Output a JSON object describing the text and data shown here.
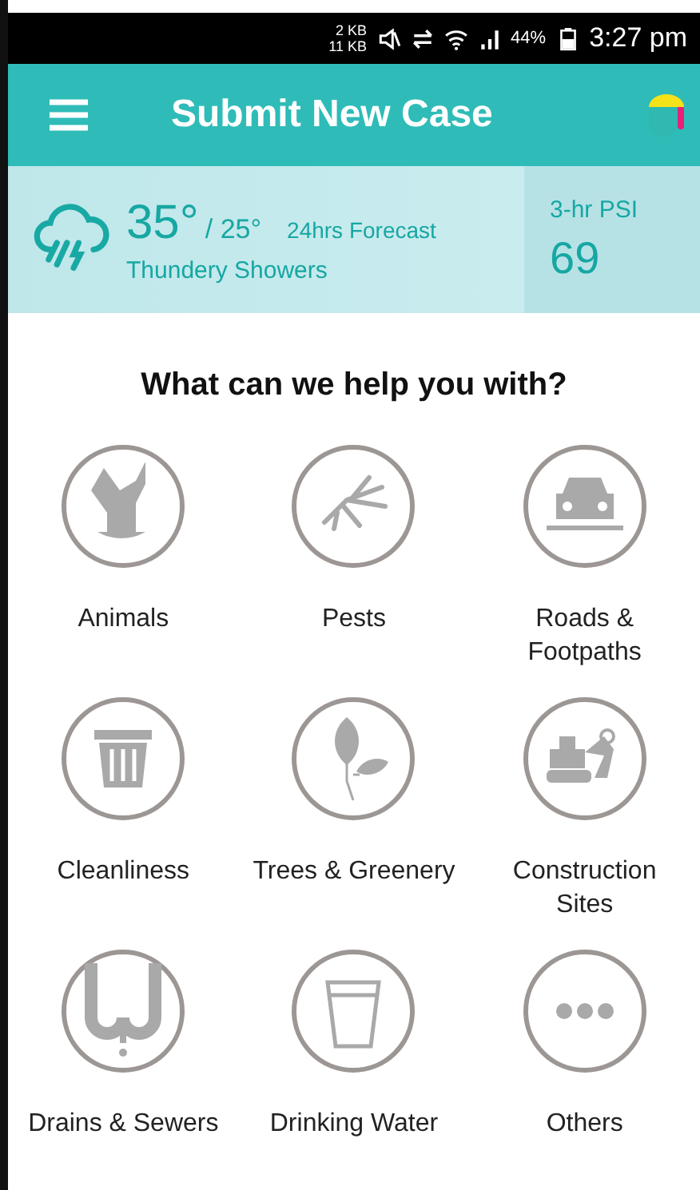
{
  "status_bar": {
    "upload": "2 KB",
    "download": "11 KB",
    "battery": "44%",
    "time": "3:27 pm"
  },
  "app_bar": {
    "title": "Submit New Case"
  },
  "weather": {
    "high": "35°",
    "low": "/ 25°",
    "forecast_label": "24hrs Forecast",
    "condition": "Thundery Showers",
    "psi_label": "3-hr PSI",
    "psi_value": "69"
  },
  "heading": "What can we help you with?",
  "categories": [
    {
      "label": "Animals"
    },
    {
      "label": "Pests"
    },
    {
      "label": "Roads &\nFootpaths"
    },
    {
      "label": "Cleanliness"
    },
    {
      "label": "Trees & Greenery"
    },
    {
      "label": "Construction\nSites"
    },
    {
      "label": "Drains & Sewers"
    },
    {
      "label": "Drinking Water"
    },
    {
      "label": "Others"
    }
  ]
}
